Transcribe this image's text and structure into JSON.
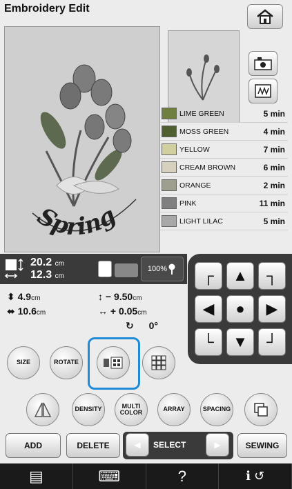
{
  "title": "Embroidery Edit",
  "preview_text": "Spring",
  "colors": [
    {
      "name": "LIME GREEN",
      "time": "5 min",
      "swatch": "#6f7f3f"
    },
    {
      "name": "MOSS GREEN",
      "time": "4 min",
      "swatch": "#4f5f2f"
    },
    {
      "name": "YELLOW",
      "time": "7 min",
      "swatch": "#cfcf9f"
    },
    {
      "name": "CREAM BROWN",
      "time": "6 min",
      "swatch": "#d6d0bf"
    },
    {
      "name": "ORANGE",
      "time": "2 min",
      "swatch": "#9f9f8f"
    },
    {
      "name": "PINK",
      "time": "11 min",
      "swatch": "#7f7f7f"
    },
    {
      "name": "LIGHT LILAC",
      "time": "5 min",
      "swatch": "#a8a8a8"
    }
  ],
  "size": {
    "width": "20.2",
    "height": "12.3",
    "unit": "cm"
  },
  "zoom": "100%",
  "position": {
    "height": "4.9",
    "width": "10.6",
    "vertical_offset": "− 9.50",
    "horizontal_offset": "+ 0.05",
    "rotation": "0°",
    "unit": "cm"
  },
  "buttons": {
    "size": "SIZE",
    "rotate": "ROTATE",
    "density": "DENSITY",
    "multi_color": "MULTI\nCOLOR",
    "array": "ARRAY",
    "spacing": "SPACING",
    "add": "ADD",
    "delete": "DELETE",
    "select": "SELECT",
    "sewing": "SEWING"
  },
  "footer": {
    "help": "?"
  }
}
